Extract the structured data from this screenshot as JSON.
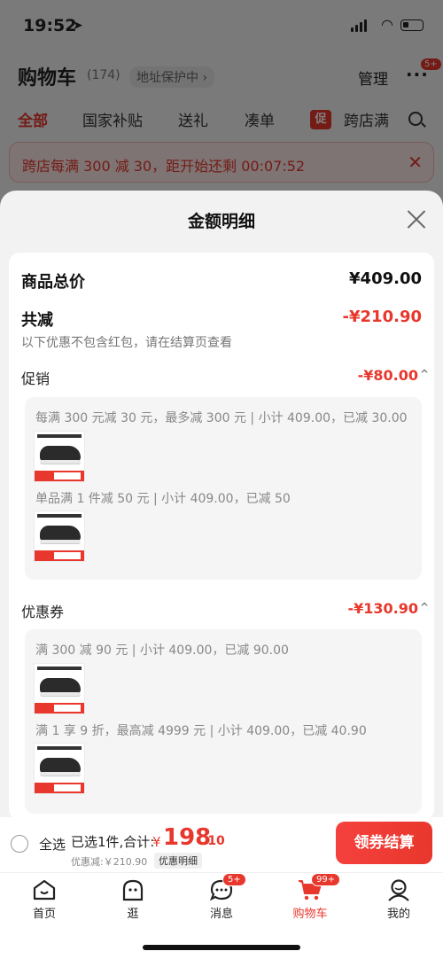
{
  "status_bar": {
    "time": "19:52"
  },
  "header": {
    "title": "购物车",
    "count": "(174)",
    "address_status": "地址保护中 ›",
    "manage": "管理",
    "more_badge": "5+"
  },
  "tabs": [
    {
      "label": "全部",
      "active": true
    },
    {
      "label": "国家补贴"
    },
    {
      "label": "送礼"
    },
    {
      "label": "凑单"
    },
    {
      "label": "跨店满",
      "tag": "促"
    }
  ],
  "banner": {
    "text": "跨店每满 300 减 30，距开始还剩 00:07:52"
  },
  "sheet": {
    "title": "金额明细",
    "total_label": "商品总价",
    "total_value": "¥409.00",
    "reduce_label": "共减",
    "reduce_value": "-¥210.90",
    "reduce_note": "以下优惠不包含红包，请在结算页查看",
    "promotion": {
      "label": "促销",
      "value": "-¥80.00",
      "rules": [
        "每满 300 元减 30 元，最多减 300 元 | 小计 409.00，已减 30.00",
        "单品满 1 件减 50 元 | 小计 409.00，已减 50"
      ]
    },
    "coupon": {
      "label": "优惠券",
      "value": "-¥130.90",
      "rules": [
        "满 300 减 90 元 | 小计 409.00，已减 90.00",
        "满 1 享 9 折，最高减 4999 元 | 小计 409.00，已减 40.90"
      ]
    }
  },
  "checkout": {
    "select_all": "全选",
    "selected_info": "已选1件,合计:",
    "currency": "¥",
    "total_int": "198",
    "total_dec": ".10",
    "discount_line": "优惠减:￥210.90",
    "detail_link": "优惠明细",
    "pay_button": "领券结算"
  },
  "tab_bar": [
    {
      "label": "首页",
      "icon": "home-icon"
    },
    {
      "label": "逛",
      "icon": "explore-icon"
    },
    {
      "label": "消息",
      "icon": "message-icon",
      "badge": "5+"
    },
    {
      "label": "购物车",
      "icon": "cart-icon",
      "badge": "99+",
      "active": true
    },
    {
      "label": "我的",
      "icon": "profile-icon"
    }
  ],
  "colors": {
    "accent": "#e8372c"
  }
}
